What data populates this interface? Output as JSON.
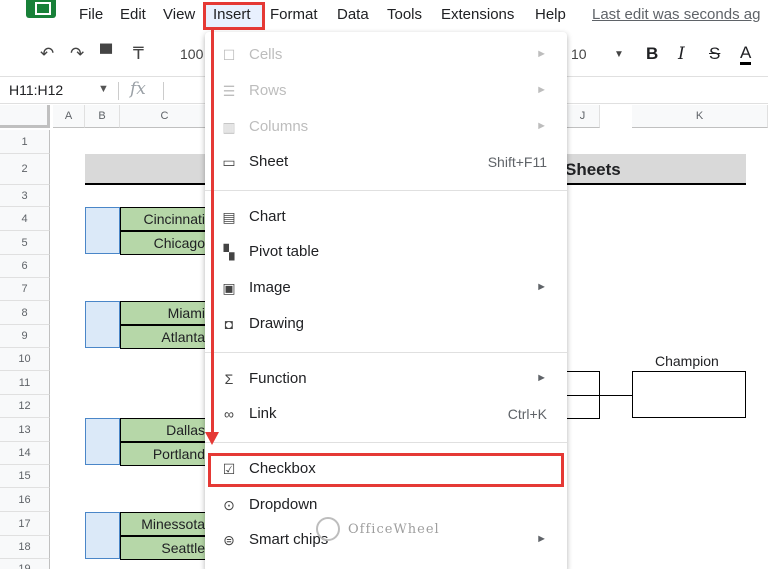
{
  "menubar": {
    "items": [
      "File",
      "Edit",
      "View",
      "Insert",
      "Format",
      "Data",
      "Tools",
      "Extensions",
      "Help"
    ],
    "last_edit": "Last edit was seconds ag"
  },
  "toolbar": {
    "zoom": "100",
    "font_size": "10",
    "bold": "B",
    "italic": "I",
    "strike": "S",
    "text_color": "A"
  },
  "formula_bar": {
    "name_box": "H11:H12",
    "fx": "fx"
  },
  "grid": {
    "columns": [
      "A",
      "B",
      "C",
      "J",
      "K"
    ],
    "rows": [
      "1",
      "2",
      "3",
      "4",
      "5",
      "6",
      "7",
      "8",
      "9",
      "10",
      "11",
      "12",
      "13",
      "14",
      "15",
      "16",
      "17",
      "18",
      "19"
    ],
    "title": "Sheets",
    "teams": [
      "Cincinnati",
      "Chicago",
      "Miami",
      "Atlanta",
      "Dallas",
      "Portland",
      "Minessota",
      "Seattle"
    ],
    "champion_label": "Champion"
  },
  "insert_menu": {
    "items": [
      {
        "label": "Cells",
        "icon": "cell-icon",
        "disabled": true,
        "submenu": true
      },
      {
        "label": "Rows",
        "icon": "rows-icon",
        "disabled": true,
        "submenu": true
      },
      {
        "label": "Columns",
        "icon": "columns-icon",
        "disabled": true,
        "submenu": true
      },
      {
        "label": "Sheet",
        "icon": "sheet-icon",
        "shortcut": "Shift+F11"
      },
      {
        "label": "Chart",
        "icon": "chart-icon"
      },
      {
        "label": "Pivot table",
        "icon": "pivot-table-icon"
      },
      {
        "label": "Image",
        "icon": "image-icon",
        "submenu": true
      },
      {
        "label": "Drawing",
        "icon": "drawing-icon"
      },
      {
        "label": "Function",
        "icon": "sigma-icon",
        "submenu": true
      },
      {
        "label": "Link",
        "icon": "link-icon",
        "shortcut": "Ctrl+K"
      },
      {
        "label": "Checkbox",
        "icon": "checkbox-icon"
      },
      {
        "label": "Dropdown",
        "icon": "dropdown-icon"
      },
      {
        "label": "Smart chips",
        "icon": "smart-chips-icon",
        "submenu": true
      }
    ]
  },
  "watermark": "OfficeWheel",
  "colors": {
    "highlight_red": "#e53935",
    "team_green": "#b6d7a8",
    "seed_blue": "#dbe9f8",
    "title_gray": "#d9d9d9"
  }
}
